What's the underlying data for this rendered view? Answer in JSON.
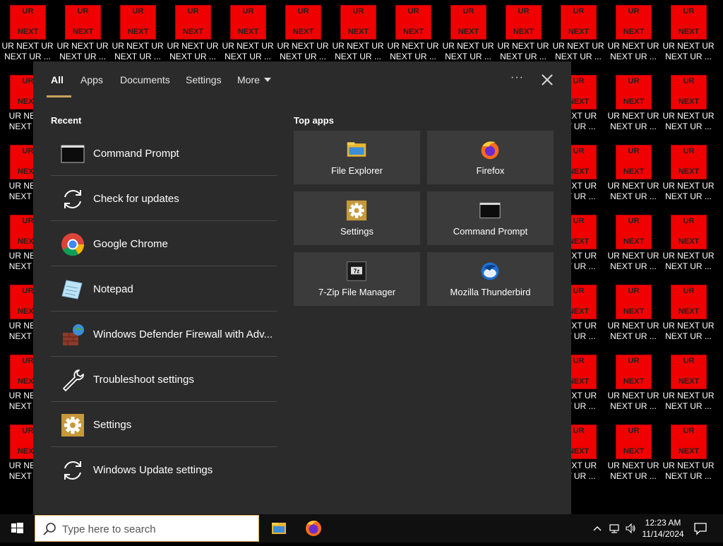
{
  "desktop": {
    "icon_tile_top": "UR",
    "icon_tile_bottom": "NEXT",
    "icon_label_line1": "UR NEXT UR",
    "icon_label_line2": "NEXT UR ...",
    "left_col_label_line1": "UR NEXT",
    "left_col_label_line2": "NEXT UR",
    "right_partial_label_line1": "NEXT UR",
    "right_partial_label_line2": "XT UR ..."
  },
  "search_panel": {
    "tabs": [
      {
        "label": "All",
        "active": true
      },
      {
        "label": "Apps",
        "active": false
      },
      {
        "label": "Documents",
        "active": false
      },
      {
        "label": "Settings",
        "active": false
      },
      {
        "label": "More",
        "active": false
      }
    ],
    "options_label": "···",
    "recent_title": "Recent",
    "recent_items": [
      {
        "label": "Command Prompt",
        "icon": "cmd-icon"
      },
      {
        "label": "Check for updates",
        "icon": "refresh-icon"
      },
      {
        "label": "Google Chrome",
        "icon": "chrome-icon"
      },
      {
        "label": "Notepad",
        "icon": "notepad-icon"
      },
      {
        "label": "Windows Defender Firewall with Adv...",
        "icon": "firewall-icon"
      },
      {
        "label": "Troubleshoot settings",
        "icon": "wrench-icon"
      },
      {
        "label": "Settings",
        "icon": "gear-icon"
      },
      {
        "label": "Windows Update settings",
        "icon": "refresh-icon"
      }
    ],
    "top_apps_title": "Top apps",
    "top_apps": [
      {
        "label": "File Explorer",
        "icon": "folder-icon"
      },
      {
        "label": "Firefox",
        "icon": "firefox-icon"
      },
      {
        "label": "Settings",
        "icon": "gear-icon"
      },
      {
        "label": "Command Prompt",
        "icon": "cmd-icon"
      },
      {
        "label": "7-Zip File Manager",
        "icon": "7zip-icon"
      },
      {
        "label": "Mozilla Thunderbird",
        "icon": "thunderbird-icon"
      }
    ]
  },
  "taskbar": {
    "search_placeholder": "Type here to search",
    "clock_time": "12:23 AM",
    "clock_date": "11/14/2024"
  },
  "colors": {
    "panel_bg": "#2b2b2b",
    "tile_bg": "#3b3b3b",
    "accent": "#c9a35a",
    "desktop_tile": "#f00000"
  }
}
